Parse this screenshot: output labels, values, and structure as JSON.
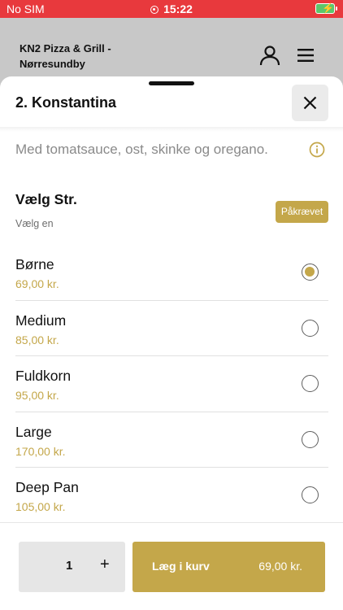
{
  "status": {
    "carrier": "No SIM",
    "time": "15:22"
  },
  "header": {
    "restaurant_name": "KN2 Pizza & Grill - Nørresundby"
  },
  "sheet": {
    "title": "2. Konstantina",
    "description": "Med tomatsauce, ost, skinke og oregano."
  },
  "option_group": {
    "title": "Vælg Str.",
    "subtitle": "Vælg en",
    "required_label": "Påkrævet",
    "options": [
      {
        "name": "Børne",
        "price": "69,00 kr.",
        "selected": true
      },
      {
        "name": "Medium",
        "price": "85,00 kr.",
        "selected": false
      },
      {
        "name": "Fuldkorn",
        "price": "95,00 kr.",
        "selected": false
      },
      {
        "name": "Large",
        "price": "170,00 kr.",
        "selected": false
      },
      {
        "name": "Deep Pan",
        "price": "105,00 kr.",
        "selected": false
      }
    ]
  },
  "cart": {
    "quantity": "1",
    "plus_label": "+",
    "add_label": "Læg i kurv",
    "total": "69,00 kr."
  },
  "colors": {
    "accent": "#c4a74a",
    "status_bar": "#e8393d",
    "battery": "#5cc66b"
  },
  "icons": [
    "record-icon",
    "battery-icon",
    "user-icon",
    "menu-icon",
    "close-icon",
    "info-icon"
  ]
}
